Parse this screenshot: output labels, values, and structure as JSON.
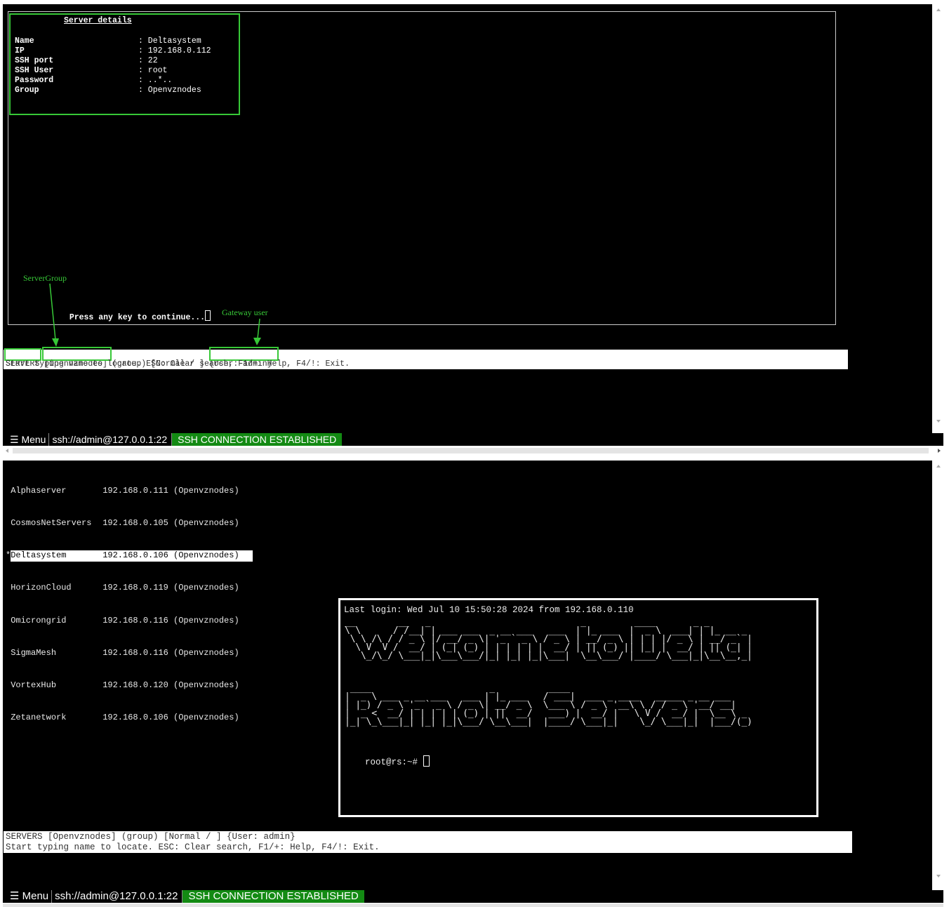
{
  "top": {
    "dialog_title": "Server details",
    "fields": [
      {
        "label": "Name",
        "value": ": Deltasystem"
      },
      {
        "label": "IP",
        "value": ": 192.168.0.112"
      },
      {
        "label": "SSH port",
        "value": ": 22"
      },
      {
        "label": "SSH User",
        "value": ": root"
      },
      {
        "label": "Password",
        "value": ": ..*.."
      },
      {
        "label": "Group",
        "value": ": Openvznodes"
      }
    ],
    "annotation_servergroup": "ServerGroup",
    "annotation_gateway_user": "Gateway user",
    "prompt": "Press any key to continue...",
    "status_line1_servers": "SERVERS",
    "status_line1_group": "[Openvznodes]",
    "status_line1_mid": " (group) [Normal / ] ",
    "status_line1_user": "{User: admin}",
    "status_line2": "Start typing name to locate. ESC: Clear search, F1/+: Help, F4/!: Exit.",
    "taskbar": {
      "menu": "☰ Menu",
      "address": "ssh://admin@127.0.0.1:22",
      "status": "SSH CONNECTION ESTABLISHED"
    }
  },
  "bottom": {
    "servers": [
      {
        "marker": " ",
        "name": "Alphaserver",
        "ip": "192.168.0.111",
        "group": "(Openvznodes)"
      },
      {
        "marker": " ",
        "name": "CosmosNetServers",
        "ip": "192.168.0.105",
        "group": "(Openvznodes)"
      },
      {
        "marker": "*",
        "name": "Deltasystem",
        "ip": "192.168.0.106",
        "group": "(Openvznodes)"
      },
      {
        "marker": " ",
        "name": "HorizonCloud",
        "ip": "192.168.0.119",
        "group": "(Openvznodes)"
      },
      {
        "marker": " ",
        "name": "Omicrongrid",
        "ip": "192.168.0.116",
        "group": "(Openvznodes)"
      },
      {
        "marker": " ",
        "name": "SigmaMesh",
        "ip": "192.168.0.116",
        "group": "(Openvznodes)"
      },
      {
        "marker": " ",
        "name": "VortexHub",
        "ip": "192.168.0.120",
        "group": "(Openvznodes)"
      },
      {
        "marker": " ",
        "name": "Zetanetwork",
        "ip": "192.168.0.106",
        "group": "(Openvznodes)"
      }
    ],
    "selected_index": 2,
    "login_line": "Last login: Wed Jul 10 15:50:28 2024 from 192.168.0.110",
    "banner_line1": "__        __   _                            _         ____       _ _        \n\\ \\      / /__| | ___ ___  _ __ ___   ___  | |_ ___  |  _ \\  ___| | |_ __ _ \n \\ \\ /\\ / / _ \\ |/ __/ _ \\| '_ ` _ \\ / _ \\ | __/ _ \\ | | | |/ _ \\ | __/ _` |\n  \\ V  V /  __/ | (_| (_) | | | | | |  __/ | || (_) || |_| |  __/ | || (_| |\n   \\_/\\_/ \\___|_|\\___\\___/|_| |_| |_|\\___|  \\__\\___/ |____/ \\___|_|\\__\\__,_|",
    "banner_line2": " ____                      _          ____                                  \n|  _ \\ ___ _ __ ___   ___ | |_ ___   / ___|  ___ _ ____   _____ _ __ ___    \n| |_) / _ \\ '_ ` _ \\ / _ \\| __/ _ \\  \\___ \\ / _ \\ '__\\ \\ / / _ \\ '__/ __|   \n|  _ <  __/ | | | | | (_) | ||  __/   ___) |  __/ |   \\ V /  __/ |  \\__ \\ _ \n|_| \\_\\___|_| |_| |_|\\___/ \\__\\___|  |____/ \\___|_|    \\_/ \\___|_|  |___/(_)",
    "shell_prompt": "root@rs:~# ",
    "status_line1": "SERVERS [Openvznodes] (group) [Normal / ] {User: admin}",
    "status_line2": "Start typing name to locate. ESC: Clear search, F1/+: Help, F4/!: Exit.",
    "taskbar": {
      "menu": "☰ Menu",
      "address": "ssh://admin@127.0.0.1:22",
      "status": "SSH CONNECTION ESTABLISHED"
    }
  }
}
